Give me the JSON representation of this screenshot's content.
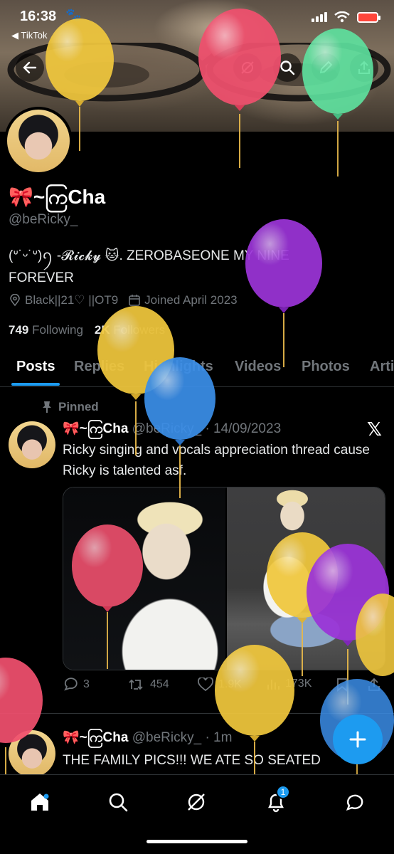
{
  "status_bar": {
    "time": "16:38",
    "back_app": "◀ TikTok"
  },
  "profile": {
    "name": "🎀~ကြCha",
    "handle": "@beRicky_",
    "bio_line1": "(ᐡ˙ᵕ˙ᐡ)ꪆ -𝓡𝓲𝓬𝓴𝔂 🐱. ZEROBASEONE MY NINE",
    "bio_line2": "FOREVER",
    "location": "Black||21♡ ||OT9",
    "joined": "Joined April 2023",
    "following_count": "749",
    "following_label": "Following",
    "followers_count": "2K",
    "followers_label": "Followers"
  },
  "tabs": [
    "Posts",
    "Replies",
    "Highlights",
    "Videos",
    "Photos",
    "Arti"
  ],
  "pinned_label": "Pinned",
  "post1": {
    "name": "🎀~ကြCha",
    "handle": "@beRicky_",
    "date": "· 14/09/2023",
    "text": "Ricky singing and vocals appreciation thread cause Ricky is talented asf.",
    "replies": "3",
    "reposts": "454",
    "likes": "1.9K",
    "views": "173K"
  },
  "post2": {
    "name": "🎀~ကြCha",
    "handle": "@beRicky_",
    "time": "· 1m",
    "text": "THE FAMILY PICS!!! WE ATE SO SEATED"
  },
  "notifications_badge": "1",
  "colors": {
    "accent": "#1d9bf0",
    "muted": "#71767b",
    "bg": "#000000"
  }
}
